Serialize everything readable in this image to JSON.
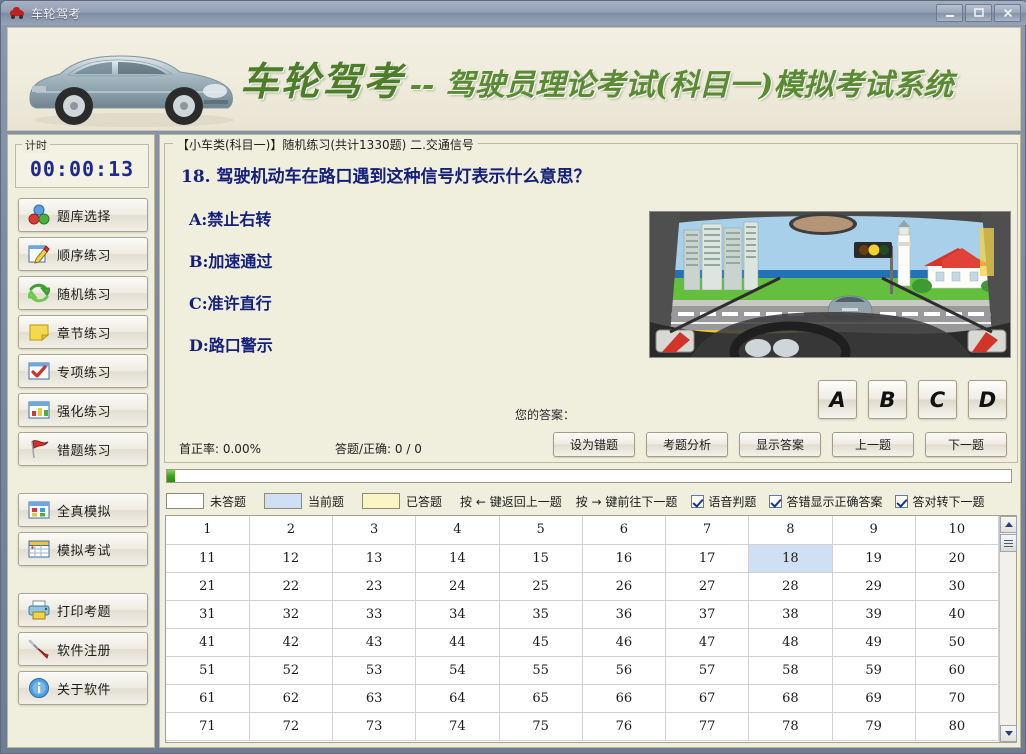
{
  "window": {
    "title": "车轮驾考",
    "icon": "car-icon",
    "buttons": {
      "minimize": "minimize-icon",
      "maximize": "maximize-icon",
      "close": "close-icon"
    }
  },
  "banner": {
    "brand": "车轮驾考",
    "subtitle": "-- 驾驶员理论考试(科目一)模拟考试系统",
    "car_image": "sedan-car-photo"
  },
  "sidebar": {
    "timer": {
      "legend": "计时",
      "value": "00:00:13"
    },
    "buttons": [
      {
        "label": "题库选择",
        "icon": "blocks-icon"
      },
      {
        "label": "顺序练习",
        "icon": "pencil-icon"
      },
      {
        "label": "随机练习",
        "icon": "shuffle-icon"
      },
      {
        "label": "章节练习",
        "icon": "note-icon"
      },
      {
        "label": "专项练习",
        "icon": "check-icon"
      },
      {
        "label": "强化练习",
        "icon": "chart-icon"
      },
      {
        "label": "错题练习",
        "icon": "flag-icon"
      },
      {
        "label": "全真模拟",
        "icon": "grid-icon"
      },
      {
        "label": "模拟考试",
        "icon": "calendar-icon"
      },
      {
        "label": "打印考题",
        "icon": "printer-icon"
      },
      {
        "label": "软件注册",
        "icon": "screwdriver-icon"
      },
      {
        "label": "关于软件",
        "icon": "info-icon"
      }
    ]
  },
  "question": {
    "breadcrumb": "【小车类(科目一)】随机练习(共计1330题) 二.交通信号",
    "title": "18. 驾驶机动车在路口遇到这种信号灯表示什么意思？",
    "options": [
      {
        "key": "A",
        "text": "A:禁止右转"
      },
      {
        "key": "B",
        "text": "B:加速通过"
      },
      {
        "key": "C",
        "text": "C:准许直行"
      },
      {
        "key": "D",
        "text": "D:路口警示"
      }
    ],
    "image_alt": "driver-view-intersection-yellow-light",
    "your_answer_label": "您的答案：",
    "answer_buttons": [
      "A",
      "B",
      "C",
      "D"
    ]
  },
  "stats": {
    "accuracy": "首正率: 0.00%",
    "answered": "答题/正确: 0 / 0"
  },
  "actions": [
    {
      "label": "设为错题"
    },
    {
      "label": "考题分析"
    },
    {
      "label": "显示答案"
    },
    {
      "label": "上一题"
    },
    {
      "label": "下一题"
    }
  ],
  "progress": {
    "percent": 1
  },
  "legend": {
    "items": [
      {
        "label": "未答题",
        "color": "#ffffff"
      },
      {
        "label": "当前题",
        "color": "#cfe0f5"
      },
      {
        "label": "已答题",
        "color": "#fbf4c3"
      }
    ],
    "hints": [
      "按 ← 键返回上一题",
      "按 → 键前往下一题"
    ],
    "checkboxes": [
      {
        "label": "语音判题",
        "checked": true
      },
      {
        "label": "答错显示正确答案",
        "checked": true
      },
      {
        "label": "答对转下一题",
        "checked": true
      }
    ]
  },
  "grid": {
    "columns": 10,
    "current": 18,
    "rows": [
      [
        1,
        2,
        3,
        4,
        5,
        6,
        7,
        8,
        9,
        10
      ],
      [
        11,
        12,
        13,
        14,
        15,
        16,
        17,
        18,
        19,
        20
      ],
      [
        21,
        22,
        23,
        24,
        25,
        26,
        27,
        28,
        29,
        30
      ],
      [
        31,
        32,
        33,
        34,
        35,
        36,
        37,
        38,
        39,
        40
      ],
      [
        41,
        42,
        43,
        44,
        45,
        46,
        47,
        48,
        49,
        50
      ],
      [
        51,
        52,
        53,
        54,
        55,
        56,
        57,
        58,
        59,
        60
      ],
      [
        61,
        62,
        63,
        64,
        65,
        66,
        67,
        68,
        69,
        70
      ],
      [
        71,
        72,
        73,
        74,
        75,
        76,
        77,
        78,
        79,
        80
      ]
    ]
  },
  "colors": {
    "brand_green": "#4e7d2a",
    "question_blue": "#14207a",
    "panel_bg": "#f0eedd",
    "current_cell": "#cfe0f5",
    "answered_cell": "#fbf4c3"
  }
}
